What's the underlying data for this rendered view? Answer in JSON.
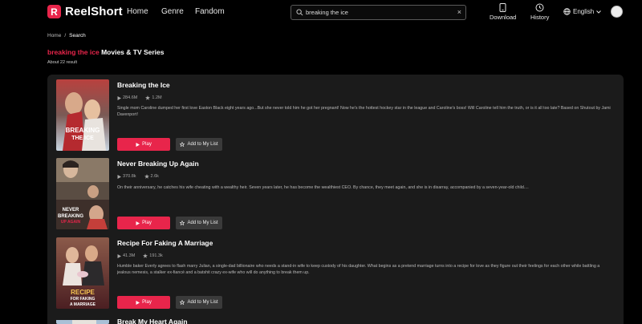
{
  "brand": {
    "name": "ReelShort",
    "logo_letter": "R",
    "accent": "#e8254b"
  },
  "nav": {
    "home": "Home",
    "genre": "Genre",
    "fandom": "Fandom"
  },
  "search": {
    "value": "breaking the ice",
    "clear": "×"
  },
  "toolbar": {
    "download": "Download",
    "history": "History",
    "language": "English"
  },
  "breadcrumb": {
    "home": "Home",
    "sep": "/",
    "current": "Search"
  },
  "results": {
    "keyword": "breaking the ice",
    "suffix": " Movies & TV Series",
    "count": "About 22 result"
  },
  "buttons": {
    "play": "Play",
    "add": "Add to My List"
  },
  "items": [
    {
      "title": "Breaking the Ice",
      "views": "284.6M",
      "likes": "1.2M",
      "description": "Single mom Caroline dumped her first love Easton Black eight years ago...But she never told him he got her pregnant! Now he's the hottest hockey star in the league and Caroline's boss! Will Caroline tell him the truth, or is it all too late? Based on Shutout by Jami Davenport!",
      "poster_text": "BREAKING THE ICE"
    },
    {
      "title": "Never Breaking Up Again",
      "views": "370.8k",
      "likes": "2.6k",
      "description": "On their anniversary, he catches his wife cheating with a wealthy heir. Seven years later, he has become the wealthiest CEO. By chance, they meet again, and she is in disarray, accompanied by a seven-year-old child....",
      "poster_text": "NEVER BREAKING UP AGAIN"
    },
    {
      "title": "Recipe For Faking A Marriage",
      "views": "41.3M",
      "likes": "191.3k",
      "description": "Humble baker Everly agrees to flash marry Julian, a single-dad billionaire who needs a stand-in wife to keep custody of his daughter. What begins as a pretend marriage turns into a recipe for love as they figure out their feelings for each other while battling a jealous nemesis, a stalker ex-fiancé and a batshit crazy ex-wife who will do anything to break them up.",
      "poster_text": "RECIPE FOR FAKING A MARRIAGE"
    },
    {
      "title": "Break My Heart Again"
    }
  ]
}
